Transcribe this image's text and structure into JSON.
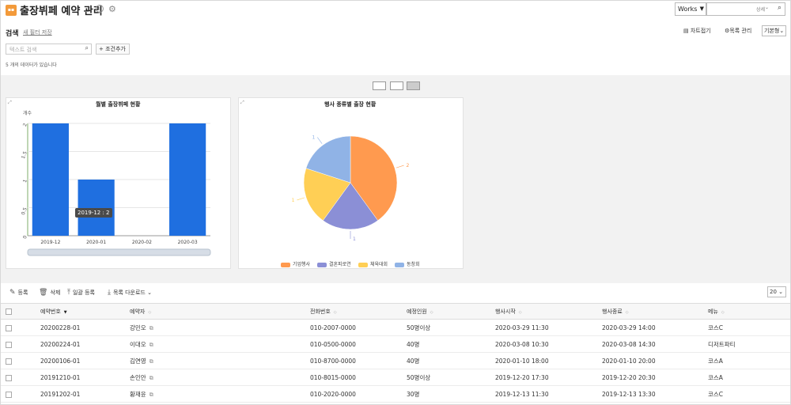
{
  "header": {
    "app_icon": "app-icon",
    "title": "출장뷔페 예약 관리",
    "works_select": "Works",
    "search_detail": "상세",
    "icons": {
      "info": "info-icon",
      "gear": "gear-icon",
      "search": "search-icon"
    }
  },
  "search": {
    "label": "검색",
    "save_filter": "새 필터 저장",
    "text_placeholder": "텍스트 검색",
    "add_condition": "조건추가",
    "result_count": "5 개의 데이터가 있습니다"
  },
  "right_tools": {
    "chart_toggle": "차트접기",
    "list_manage": "목록 관리",
    "view_select": "기본형"
  },
  "chart_data": [
    {
      "type": "bar",
      "title": "월별 출장뷔페 현황",
      "ylabel": "개수",
      "categories": [
        "2019-12",
        "2020-01",
        "2020-02",
        "2020-03"
      ],
      "values": [
        2,
        1,
        0,
        2
      ],
      "ylim": [
        0,
        2
      ],
      "yticks": [
        "0",
        "0.5",
        "1",
        "1.5",
        "2"
      ],
      "color": "#1f6fe0",
      "tooltip": "2019-12 : 2"
    },
    {
      "type": "pie",
      "title": "행사 종류별 출장 현황",
      "categories": [
        "기업행사",
        "결혼피로연",
        "체육대회",
        "동창회"
      ],
      "values": [
        2,
        1,
        1,
        1
      ],
      "colors": [
        "#ff9a4f",
        "#8b8fd6",
        "#ffcf55",
        "#90b3e6"
      ],
      "labels": [
        "2",
        "1",
        "1",
        "1"
      ]
    }
  ],
  "toolbar": {
    "register": "등록",
    "delete": "삭제",
    "bulk_register": "일괄 등록",
    "download": "목록 다운로드",
    "page_size": "20"
  },
  "table": {
    "columns": [
      "예약번호",
      "예약자",
      "전화번호",
      "예정인원",
      "행사시작",
      "행사종료",
      "메뉴"
    ],
    "rows": [
      [
        "20200228-01",
        "강민오",
        "010-2007-0000",
        "50명이상",
        "2020-03-29 11:30",
        "2020-03-29 14:00",
        "코스C"
      ],
      [
        "20200224-01",
        "이대오",
        "010-0500-0000",
        "40명",
        "2020-03-08 10:30",
        "2020-03-08 14:30",
        "디저트파티"
      ],
      [
        "20200106-01",
        "김연영",
        "010-8700-0000",
        "40명",
        "2020-01-10 18:00",
        "2020-01-10 20:00",
        "코스A"
      ],
      [
        "20191210-01",
        "손인안",
        "010-8015-0000",
        "50명이상",
        "2019-12-20 17:30",
        "2019-12-20 20:30",
        "코스A"
      ],
      [
        "20191202-01",
        "황재윤",
        "010-2020-0000",
        "30명",
        "2019-12-13 11:30",
        "2019-12-13 13:30",
        "코스C"
      ]
    ]
  }
}
